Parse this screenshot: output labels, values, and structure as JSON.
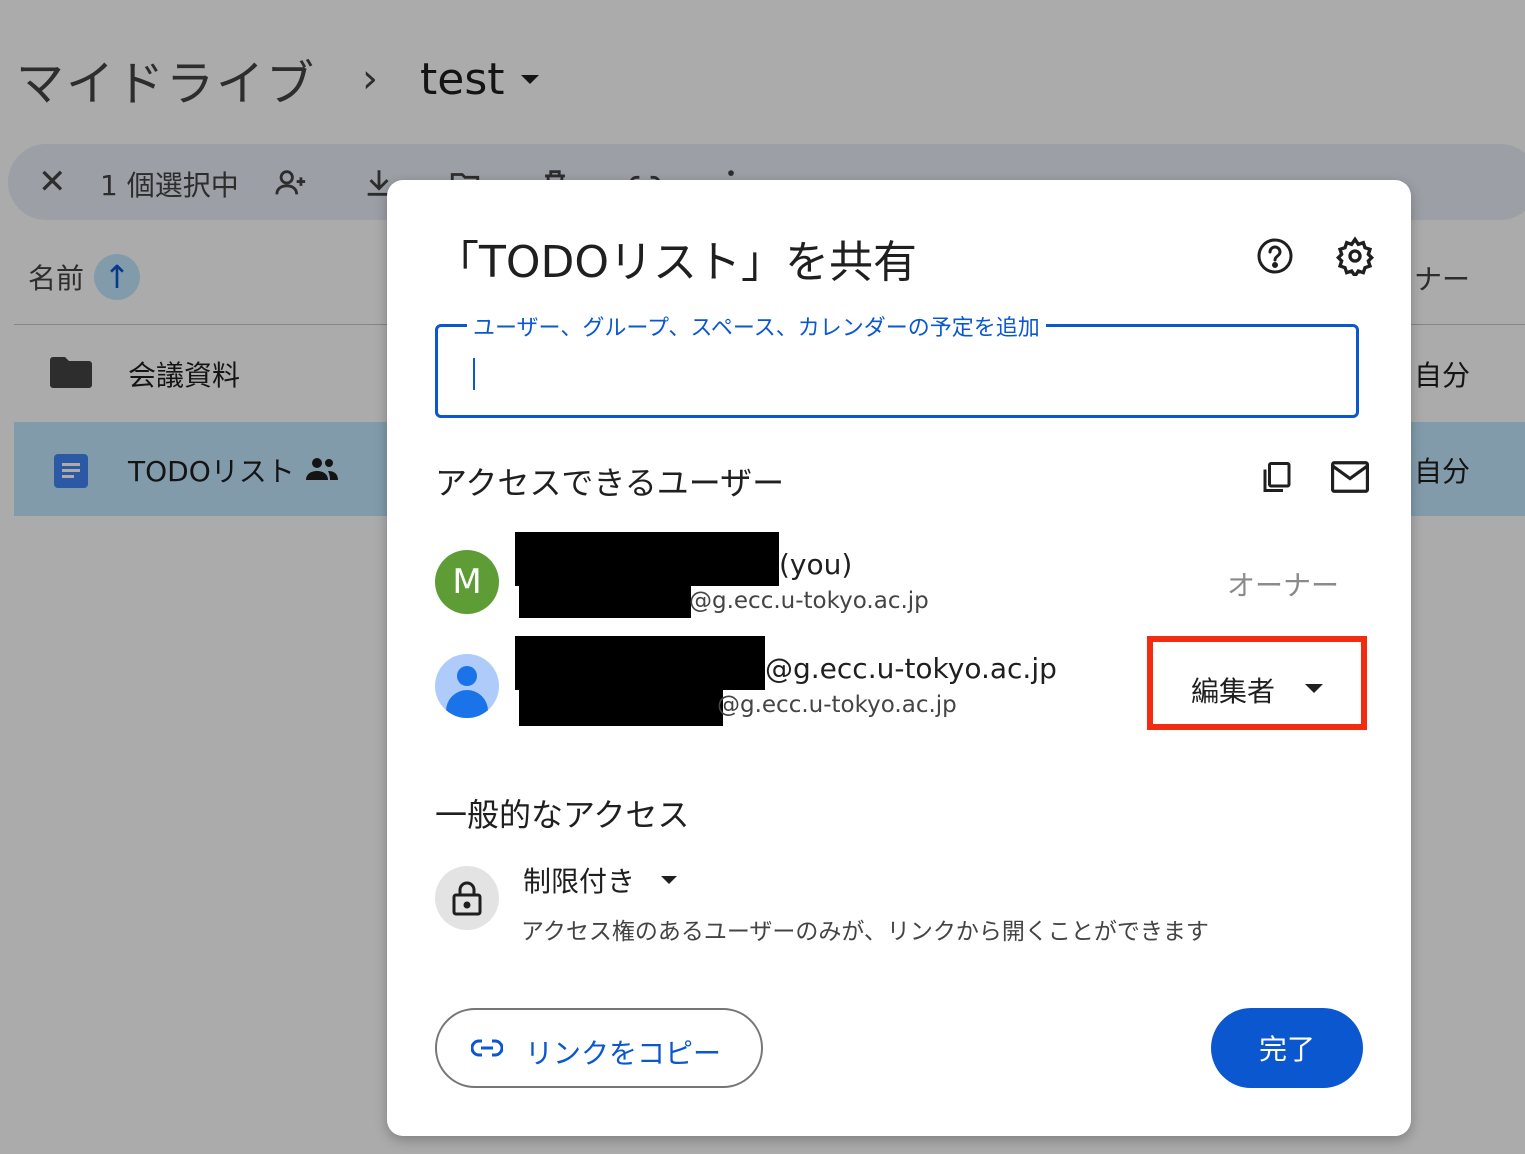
{
  "background": {
    "breadcrumb": {
      "root": "マイドライブ",
      "separator": "›",
      "current": "test"
    },
    "selection_bar": {
      "close": "✕",
      "count_label": "1 個選択中",
      "icons": [
        "add-person-icon",
        "download-icon",
        "move-folder-icon",
        "trash-icon",
        "link-icon",
        "more-vert-icon"
      ]
    },
    "column_header": {
      "name": "名前",
      "sort": "↑",
      "owner": "ナー"
    },
    "files": [
      {
        "name": "会議資料",
        "owner": "自分",
        "icon": "folder-icon"
      },
      {
        "name": "TODOリスト",
        "owner": "自分",
        "icon": "doc-icon",
        "shared": true
      }
    ]
  },
  "dialog": {
    "title": "「TODOリスト」を共有",
    "add_field_label": "ユーザー、グループ、スペース、カレンダーの予定を追加",
    "people_section_title": "アクセスできるユーザー",
    "people": [
      {
        "avatar_letter": "M",
        "name_suffix": "(you)",
        "email_suffix": "@g.ecc.u-tokyo.ac.jp",
        "role": "オーナー"
      },
      {
        "name_suffix": "@g.ecc.u-tokyo.ac.jp",
        "email_suffix": "@g.ecc.u-tokyo.ac.jp",
        "role": "編集者"
      }
    ],
    "general_access_title": "一般的なアクセス",
    "access_level": "制限付き",
    "access_description": "アクセス権のあるユーザーのみが、リンクから開くことができます",
    "copy_link_label": "リンクをコピー",
    "done_label": "完了"
  },
  "colors": {
    "accent": "#0b57d0",
    "highlight_box": "#f32b10",
    "avatar_m": "#5e9c36",
    "selected_row": "#c2e7ff"
  }
}
